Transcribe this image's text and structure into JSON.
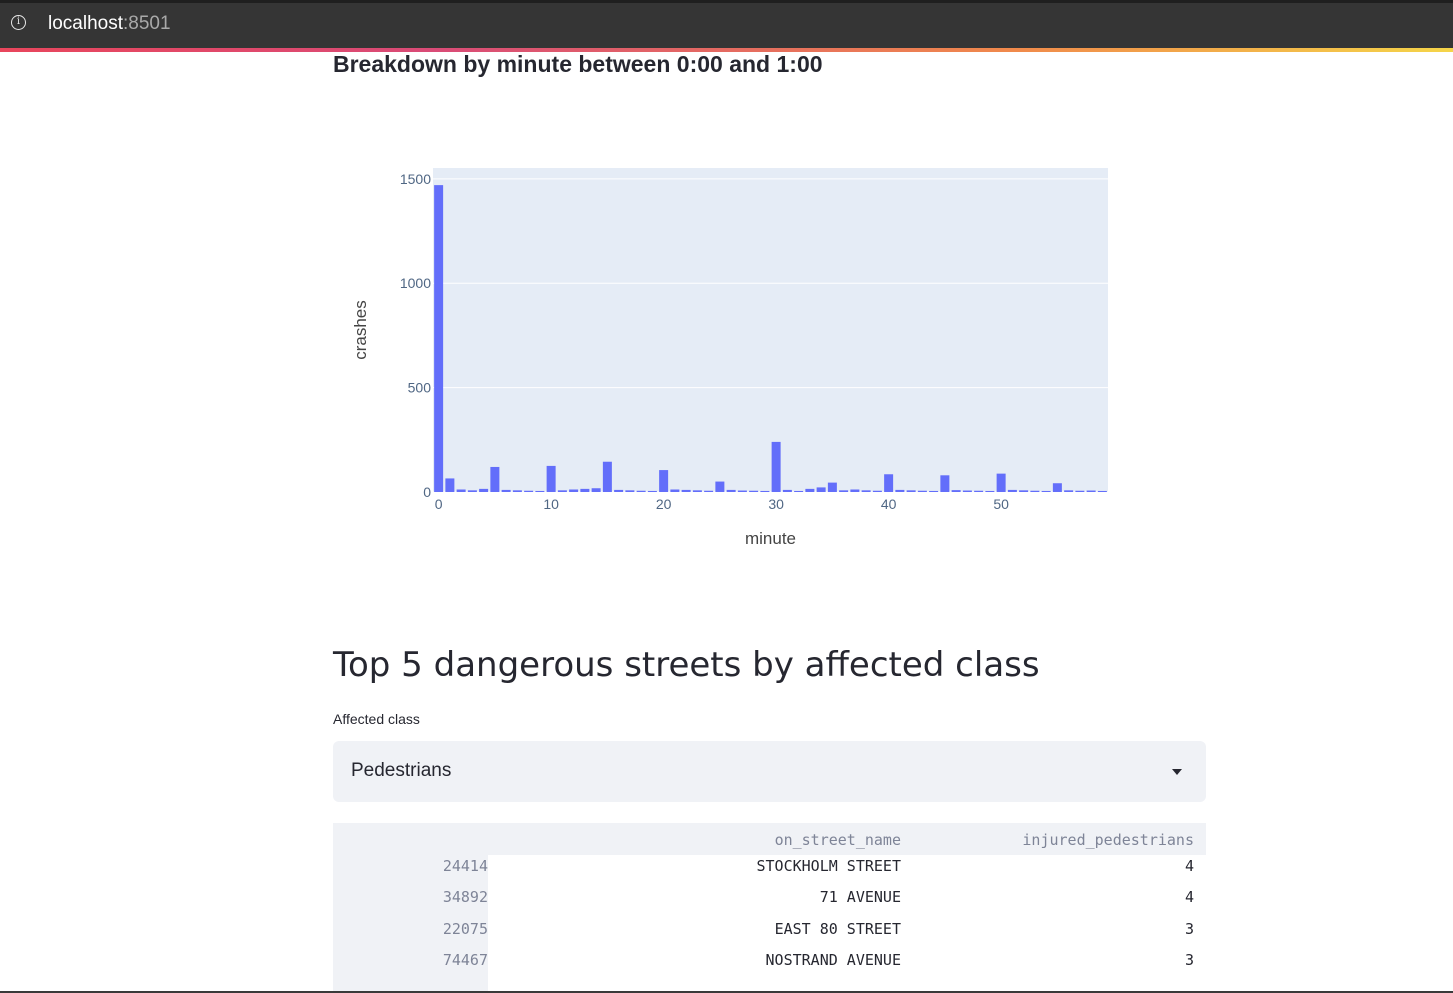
{
  "browser": {
    "url_host": "localhost",
    "url_port": ":8501",
    "info_icon": "info-icon"
  },
  "chart_section": {
    "title": "Breakdown by minute between 0:00 and 1:00"
  },
  "chart_data": {
    "type": "bar",
    "x": [
      0,
      1,
      2,
      3,
      4,
      5,
      6,
      7,
      8,
      9,
      10,
      11,
      12,
      13,
      14,
      15,
      16,
      17,
      18,
      19,
      20,
      21,
      22,
      23,
      24,
      25,
      26,
      27,
      28,
      29,
      30,
      31,
      32,
      33,
      34,
      35,
      36,
      37,
      38,
      39,
      40,
      41,
      42,
      43,
      44,
      45,
      46,
      47,
      48,
      49,
      50,
      51,
      52,
      53,
      54,
      55,
      56,
      57,
      58,
      59
    ],
    "values": [
      1470,
      65,
      12,
      8,
      15,
      120,
      10,
      8,
      6,
      5,
      125,
      8,
      12,
      15,
      18,
      145,
      10,
      8,
      6,
      5,
      105,
      12,
      10,
      8,
      6,
      50,
      10,
      7,
      6,
      5,
      240,
      10,
      5,
      15,
      22,
      45,
      8,
      12,
      8,
      6,
      85,
      10,
      8,
      6,
      5,
      80,
      9,
      7,
      6,
      5,
      88,
      10,
      8,
      6,
      5,
      42,
      8,
      6,
      7,
      5
    ],
    "xlabel": "minute",
    "ylabel": "crashes",
    "xlim": [
      -0.5,
      59.5
    ],
    "ylim": [
      0,
      1500
    ],
    "xticks": [
      0,
      10,
      20,
      30,
      40,
      50
    ],
    "yticks": [
      0,
      500,
      1000,
      1500
    ],
    "bar_color": "#636efa",
    "plot_bg": "#e5ecf6",
    "grid": true
  },
  "streets_section": {
    "heading": "Top 5 dangerous streets by affected class",
    "select_label": "Affected class",
    "select_value": "Pedestrians"
  },
  "table": {
    "columns": [
      "on_street_name",
      "injured_pedestrians"
    ],
    "rows": [
      {
        "index": "24414",
        "street": "STOCKHOLM STREET",
        "count": "4"
      },
      {
        "index": "34892",
        "street": "71 AVENUE",
        "count": "4"
      },
      {
        "index": "22075",
        "street": "EAST 80 STREET",
        "count": "3"
      },
      {
        "index": "74467",
        "street": "NOSTRAND AVENUE",
        "count": "3"
      }
    ]
  }
}
